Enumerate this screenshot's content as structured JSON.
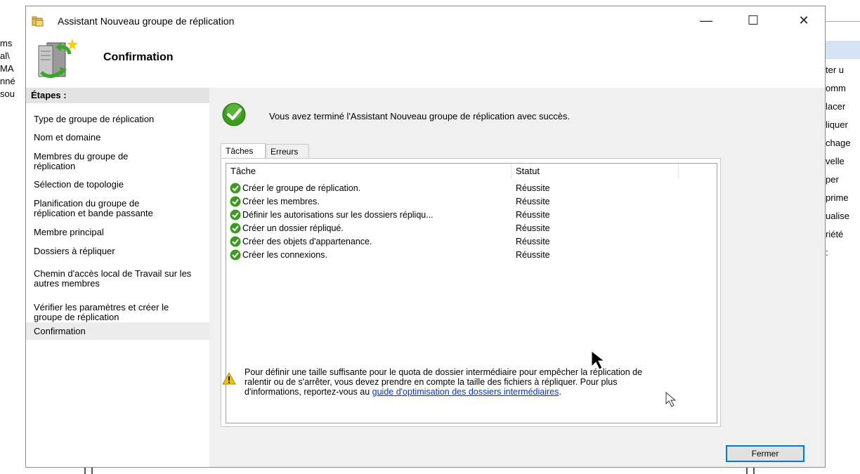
{
  "background": {
    "left_lines": [
      "ms",
      "al\\",
      "MA",
      "nné",
      "sou"
    ],
    "right_lines": [
      "ter u",
      "omm",
      "lacer",
      "liquer",
      "chage",
      "velle",
      "per",
      "prime",
      "ualise",
      "riété",
      ":"
    ]
  },
  "dialog": {
    "title": "Assistant Nouveau groupe de réplication",
    "header_title": "Confirmation",
    "minimize_glyph": "—",
    "maximize_glyph": "☐",
    "close_glyph": "✕"
  },
  "sidebar": {
    "heading": "Étapes :",
    "steps": [
      "Type de groupe de réplication",
      "Nom et domaine",
      "Membres du groupe de réplication",
      "Sélection de topologie",
      "Planification du groupe de réplication et bande passante",
      "Membre principal",
      "Dossiers à répliquer",
      "Chemin d'accès local de Travail sur les autres membres",
      "Vérifier les paramètres et créer le groupe de réplication",
      "Confirmation"
    ],
    "active_step": "Confirmation"
  },
  "content": {
    "success_message": "Vous avez terminé l'Assistant Nouveau groupe de réplication avec succès.",
    "tabs": [
      "Tâches",
      "Erreurs"
    ],
    "active_tab": "Tâches",
    "columns": [
      "Tâche",
      "Statut"
    ],
    "rows": [
      {
        "task": "Créer le groupe de réplication.",
        "status": "Réussite"
      },
      {
        "task": "Créer les membres.",
        "status": "Réussite"
      },
      {
        "task": "Définir les autorisations sur les dossiers répliqu...",
        "status": "Réussite"
      },
      {
        "task": "Créer un dossier répliqué.",
        "status": "Réussite"
      },
      {
        "task": "Créer des objets d'appartenance.",
        "status": "Réussite"
      },
      {
        "task": "Créer les connexions.",
        "status": "Réussite"
      }
    ],
    "warning_text": "Pour définir une taille suffisante pour le quota de dossier intermédiaire pour empêcher la réplication de ralentir ou de s'arrêter, vous devez prendre en compte la taille des fichiers à répliquer. Pour plus d'informations, reportez-vous au ",
    "warning_link": "guide d'optimisation des dossiers intermédiaires",
    "warning_end": ".",
    "close_button": "Fermer"
  },
  "colors": {
    "accent": "#0078d7",
    "success": "#3c9a1e",
    "warning": "#f2c300",
    "link": "#0033cc"
  }
}
